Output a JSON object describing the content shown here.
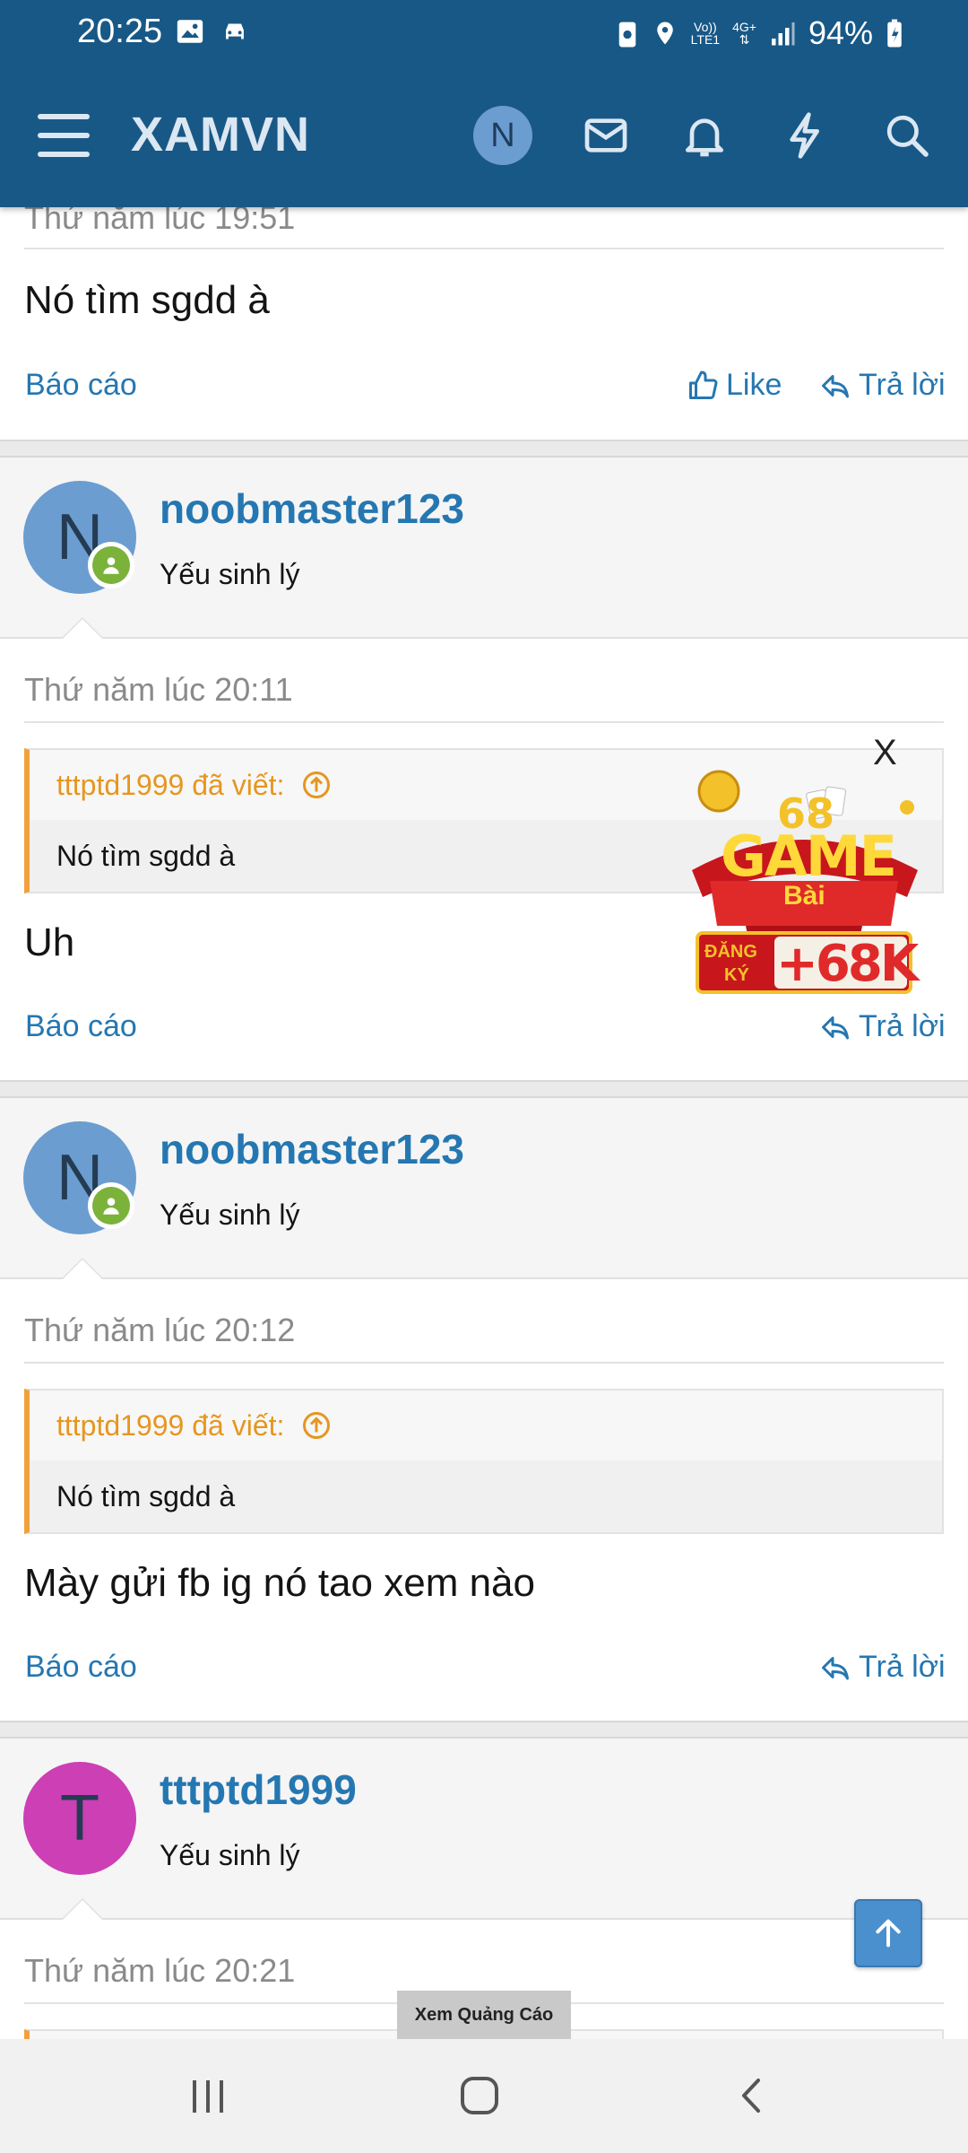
{
  "status": {
    "time": "20:25",
    "lte_top": "Vo))",
    "lte_bottom": "LTE1",
    "net": "4G+",
    "battery": "94%"
  },
  "header": {
    "logo": "XAMVN",
    "avatar_letter": "N"
  },
  "posts": [
    {
      "date": "Thứ năm lúc 19:51",
      "message": "Nó tìm sgdd à",
      "report": "Báo cáo",
      "like": "Like",
      "reply": "Trả lời"
    },
    {
      "user": {
        "letter": "N",
        "name": "noobmaster123",
        "title": "Yếu sinh lý",
        "color": "#6b9dd1"
      },
      "date": "Thứ năm lúc 20:11",
      "quote": {
        "author": "tttptd1999 đã viết:",
        "text": "Nó tìm sgdd à"
      },
      "message": "Uh",
      "report": "Báo cáo",
      "reply": "Trả lời"
    },
    {
      "user": {
        "letter": "N",
        "name": "noobmaster123",
        "title": "Yếu sinh lý",
        "color": "#6b9dd1"
      },
      "date": "Thứ năm lúc 20:12",
      "quote": {
        "author": "tttptd1999 đã viết:",
        "text": "Nó tìm sgdd à"
      },
      "message": "Mày gửi fb ig nó tao xem nào",
      "report": "Báo cáo",
      "reply": "Trả lời"
    },
    {
      "user": {
        "letter": "T",
        "name": "tttptd1999",
        "title": "Yếu sinh lý",
        "color": "#cc3fb5"
      },
      "date": "Thứ năm lúc 20:21"
    }
  ],
  "ad": {
    "close": "X",
    "num": "68",
    "game": "GAME",
    "bai": "Bài",
    "dang": "ĐĂNG",
    "ky": "KÝ",
    "bonus": "+68K",
    "view_ad": "Xem Quảng Cáo"
  },
  "colors": {
    "header": "#185886",
    "link": "#2577b1",
    "quote_accent": "#f1a13c",
    "online": "#7bb23a"
  }
}
